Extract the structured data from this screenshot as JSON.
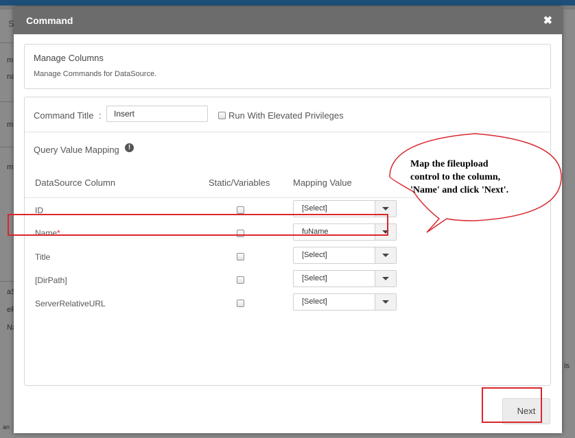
{
  "background": {
    "fragments": [
      "S",
      "m",
      "na",
      "m",
      "m",
      "aS",
      "eR",
      "Na",
      "is",
      "an"
    ]
  },
  "modal": {
    "title": "Command",
    "close_glyph": "✖"
  },
  "info_card": {
    "title": "Manage Columns",
    "description": "Manage Commands for DataSource."
  },
  "command": {
    "title_label": "Command Title",
    "separator": ":",
    "title_value": "Insert",
    "elevated_label": "Run With Elevated Privileges",
    "elevated_checked": false
  },
  "mapping": {
    "section_label": "Query Value Mapping",
    "info_icon": "exclamation-circle-icon",
    "headers": {
      "column": "DataSource Column",
      "static": "Static/Variables",
      "value": "Mapping Value"
    },
    "rows": [
      {
        "label": "ID",
        "required": "",
        "static_checked": false,
        "value": "[Select]"
      },
      {
        "label": "Name",
        "required": "*",
        "static_checked": false,
        "value": "fuName"
      },
      {
        "label": "Title",
        "required": "",
        "static_checked": false,
        "value": "[Select]"
      },
      {
        "label": "[DirPath]",
        "required": "",
        "static_checked": false,
        "value": "[Select]"
      },
      {
        "label": "ServerRelativeURL",
        "required": "",
        "static_checked": false,
        "value": "[Select]"
      }
    ]
  },
  "callout": {
    "lines": [
      "Map the fileupload",
      "control to the column,",
      "'Name' and click 'Next'."
    ]
  },
  "footer": {
    "next_label": "Next"
  },
  "colors": {
    "header": "#6c6c6c",
    "highlight": "#d8262c",
    "required": "#d62b2b"
  }
}
